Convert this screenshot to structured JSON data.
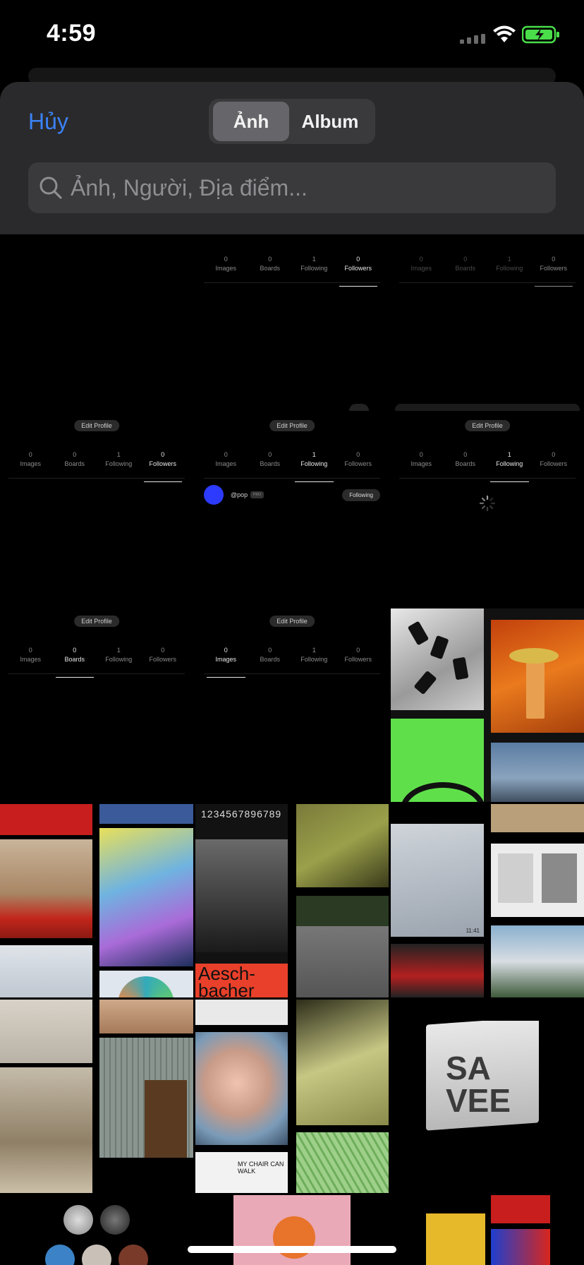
{
  "status_bar": {
    "time": "4:59"
  },
  "sheet": {
    "cancel_label": "Hủy",
    "tabs": [
      {
        "label": "Ảnh",
        "selected": true
      },
      {
        "label": "Album",
        "selected": false
      }
    ],
    "search": {
      "placeholder": "Ảnh, Người, Địa điểm...",
      "value": ""
    }
  },
  "profile_common": {
    "edit_profile_label": "Edit Profile",
    "stat_labels": [
      "Images",
      "Boards",
      "Following",
      "Followers"
    ],
    "stat_values": [
      "0",
      "0",
      "1",
      "0"
    ]
  },
  "profile_cells": [
    {
      "active_tab": "Followers"
    },
    {
      "active_tab": "Followers"
    },
    {
      "active_tab": "Followers"
    },
    {
      "active_tab": "Following"
    },
    {
      "active_tab": "Following"
    },
    {
      "active_tab": "Boards"
    },
    {
      "active_tab": "Images"
    }
  ],
  "following_list": {
    "handle": "@pop",
    "badge": "PRO",
    "button_label": "Following"
  },
  "image_tiles": {
    "poster_numbers": "1234567896789",
    "poster_name": "Aesch-\nbacher",
    "chair_caption": "MY CHAIR CAN WALK",
    "logo_text_1": "SA",
    "logo_text_2": "VEE",
    "screenshot_corner_text": "11:41"
  },
  "colors": {
    "accent": "#3b82f6",
    "sheet_bg": "#2a2a2c",
    "input_bg": "#3a3a3c"
  }
}
